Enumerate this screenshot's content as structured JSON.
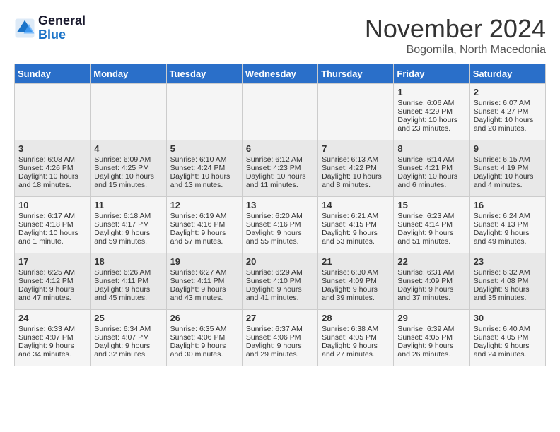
{
  "header": {
    "logo_line1": "General",
    "logo_line2": "Blue",
    "title": "November 2024",
    "subtitle": "Bogomila, North Macedonia"
  },
  "days_of_week": [
    "Sunday",
    "Monday",
    "Tuesday",
    "Wednesday",
    "Thursday",
    "Friday",
    "Saturday"
  ],
  "weeks": [
    [
      {
        "day": "",
        "info": ""
      },
      {
        "day": "",
        "info": ""
      },
      {
        "day": "",
        "info": ""
      },
      {
        "day": "",
        "info": ""
      },
      {
        "day": "",
        "info": ""
      },
      {
        "day": "1",
        "info": "Sunrise: 6:06 AM\nSunset: 4:29 PM\nDaylight: 10 hours and 23 minutes."
      },
      {
        "day": "2",
        "info": "Sunrise: 6:07 AM\nSunset: 4:27 PM\nDaylight: 10 hours and 20 minutes."
      }
    ],
    [
      {
        "day": "3",
        "info": "Sunrise: 6:08 AM\nSunset: 4:26 PM\nDaylight: 10 hours and 18 minutes."
      },
      {
        "day": "4",
        "info": "Sunrise: 6:09 AM\nSunset: 4:25 PM\nDaylight: 10 hours and 15 minutes."
      },
      {
        "day": "5",
        "info": "Sunrise: 6:10 AM\nSunset: 4:24 PM\nDaylight: 10 hours and 13 minutes."
      },
      {
        "day": "6",
        "info": "Sunrise: 6:12 AM\nSunset: 4:23 PM\nDaylight: 10 hours and 11 minutes."
      },
      {
        "day": "7",
        "info": "Sunrise: 6:13 AM\nSunset: 4:22 PM\nDaylight: 10 hours and 8 minutes."
      },
      {
        "day": "8",
        "info": "Sunrise: 6:14 AM\nSunset: 4:21 PM\nDaylight: 10 hours and 6 minutes."
      },
      {
        "day": "9",
        "info": "Sunrise: 6:15 AM\nSunset: 4:19 PM\nDaylight: 10 hours and 4 minutes."
      }
    ],
    [
      {
        "day": "10",
        "info": "Sunrise: 6:17 AM\nSunset: 4:18 PM\nDaylight: 10 hours and 1 minute."
      },
      {
        "day": "11",
        "info": "Sunrise: 6:18 AM\nSunset: 4:17 PM\nDaylight: 9 hours and 59 minutes."
      },
      {
        "day": "12",
        "info": "Sunrise: 6:19 AM\nSunset: 4:16 PM\nDaylight: 9 hours and 57 minutes."
      },
      {
        "day": "13",
        "info": "Sunrise: 6:20 AM\nSunset: 4:16 PM\nDaylight: 9 hours and 55 minutes."
      },
      {
        "day": "14",
        "info": "Sunrise: 6:21 AM\nSunset: 4:15 PM\nDaylight: 9 hours and 53 minutes."
      },
      {
        "day": "15",
        "info": "Sunrise: 6:23 AM\nSunset: 4:14 PM\nDaylight: 9 hours and 51 minutes."
      },
      {
        "day": "16",
        "info": "Sunrise: 6:24 AM\nSunset: 4:13 PM\nDaylight: 9 hours and 49 minutes."
      }
    ],
    [
      {
        "day": "17",
        "info": "Sunrise: 6:25 AM\nSunset: 4:12 PM\nDaylight: 9 hours and 47 minutes."
      },
      {
        "day": "18",
        "info": "Sunrise: 6:26 AM\nSunset: 4:11 PM\nDaylight: 9 hours and 45 minutes."
      },
      {
        "day": "19",
        "info": "Sunrise: 6:27 AM\nSunset: 4:11 PM\nDaylight: 9 hours and 43 minutes."
      },
      {
        "day": "20",
        "info": "Sunrise: 6:29 AM\nSunset: 4:10 PM\nDaylight: 9 hours and 41 minutes."
      },
      {
        "day": "21",
        "info": "Sunrise: 6:30 AM\nSunset: 4:09 PM\nDaylight: 9 hours and 39 minutes."
      },
      {
        "day": "22",
        "info": "Sunrise: 6:31 AM\nSunset: 4:09 PM\nDaylight: 9 hours and 37 minutes."
      },
      {
        "day": "23",
        "info": "Sunrise: 6:32 AM\nSunset: 4:08 PM\nDaylight: 9 hours and 35 minutes."
      }
    ],
    [
      {
        "day": "24",
        "info": "Sunrise: 6:33 AM\nSunset: 4:07 PM\nDaylight: 9 hours and 34 minutes."
      },
      {
        "day": "25",
        "info": "Sunrise: 6:34 AM\nSunset: 4:07 PM\nDaylight: 9 hours and 32 minutes."
      },
      {
        "day": "26",
        "info": "Sunrise: 6:35 AM\nSunset: 4:06 PM\nDaylight: 9 hours and 30 minutes."
      },
      {
        "day": "27",
        "info": "Sunrise: 6:37 AM\nSunset: 4:06 PM\nDaylight: 9 hours and 29 minutes."
      },
      {
        "day": "28",
        "info": "Sunrise: 6:38 AM\nSunset: 4:05 PM\nDaylight: 9 hours and 27 minutes."
      },
      {
        "day": "29",
        "info": "Sunrise: 6:39 AM\nSunset: 4:05 PM\nDaylight: 9 hours and 26 minutes."
      },
      {
        "day": "30",
        "info": "Sunrise: 6:40 AM\nSunset: 4:05 PM\nDaylight: 9 hours and 24 minutes."
      }
    ]
  ]
}
